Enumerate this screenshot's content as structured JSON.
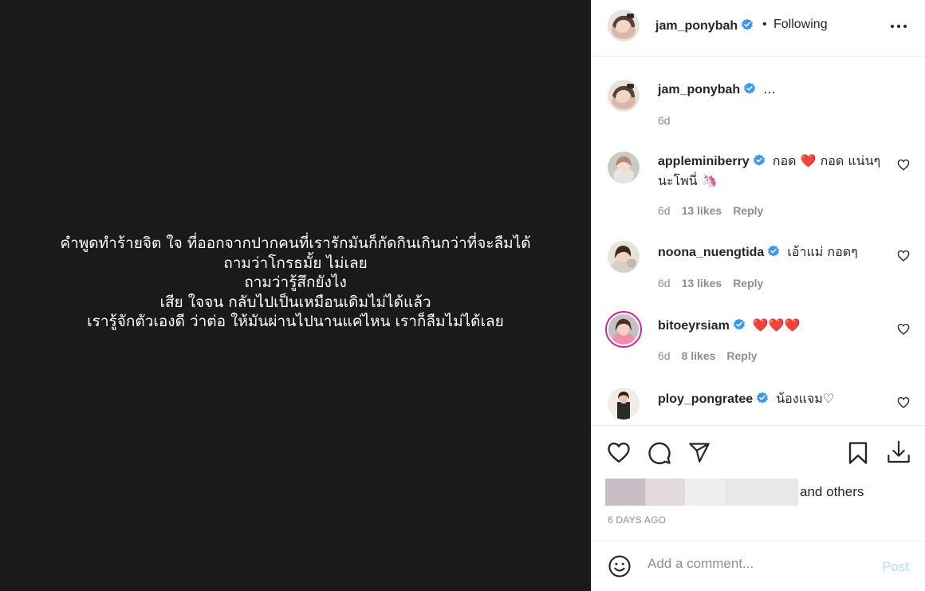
{
  "media": {
    "text": "คำพูดทำร้ายจิต ใจ ที่ออกจากปากคนที่เรารักมันก็กัดกินเกินกว่าที่จะลืมได้\nถามว่าโกรธมั้ย ไม่เลย\nถามว่ารู้สึกยังไง\nเสีย ใจจน กลับไปเป็นเหมือนเดิมไม่ได้แล้ว\nเรารู้จักตัวเองดี ว่าต่อ ให้มันผ่านไปนานแค่ไหน เราก็ลืมไม่ได้เลย"
  },
  "header": {
    "username": "jam_ponybah",
    "separator": "•",
    "follow_status": "Following",
    "more_icon": "more-horizontal-icon"
  },
  "caption": {
    "username": "jam_ponybah",
    "text": "...",
    "time": "6d"
  },
  "comments": [
    {
      "username": "appleminiberry",
      "text": "กอด ❤️ กอด แน่นๆนะโพนี่ 🦄",
      "time": "6d",
      "likes": "13 likes",
      "reply": "Reply"
    },
    {
      "username": "noona_nuengtida",
      "text": "เอ้าแม่ กอดๆ",
      "time": "6d",
      "likes": "13 likes",
      "reply": "Reply"
    },
    {
      "username": "bitoeyrsiam",
      "text": "❤️❤️❤️",
      "time": "6d",
      "likes": "8 likes",
      "reply": "Reply"
    },
    {
      "username": "ploy_pongratee",
      "text": "น้องแจม♡",
      "time": "",
      "likes": "",
      "reply": ""
    }
  ],
  "actions": {
    "icons": [
      "heart-icon",
      "comment-icon",
      "share-icon",
      "bookmark-icon",
      "download-icon"
    ],
    "liked_by_suffix": "and",
    "liked_by_others": "others",
    "posted_time": "6 DAYS AGO"
  },
  "add_comment": {
    "placeholder": "Add a comment...",
    "post_label": "Post"
  },
  "colors": {
    "verified": "#3897f0",
    "heart_red": "#ed4956",
    "post_disabled": "#b2dffc",
    "media_bg": "#1a1a1a"
  }
}
